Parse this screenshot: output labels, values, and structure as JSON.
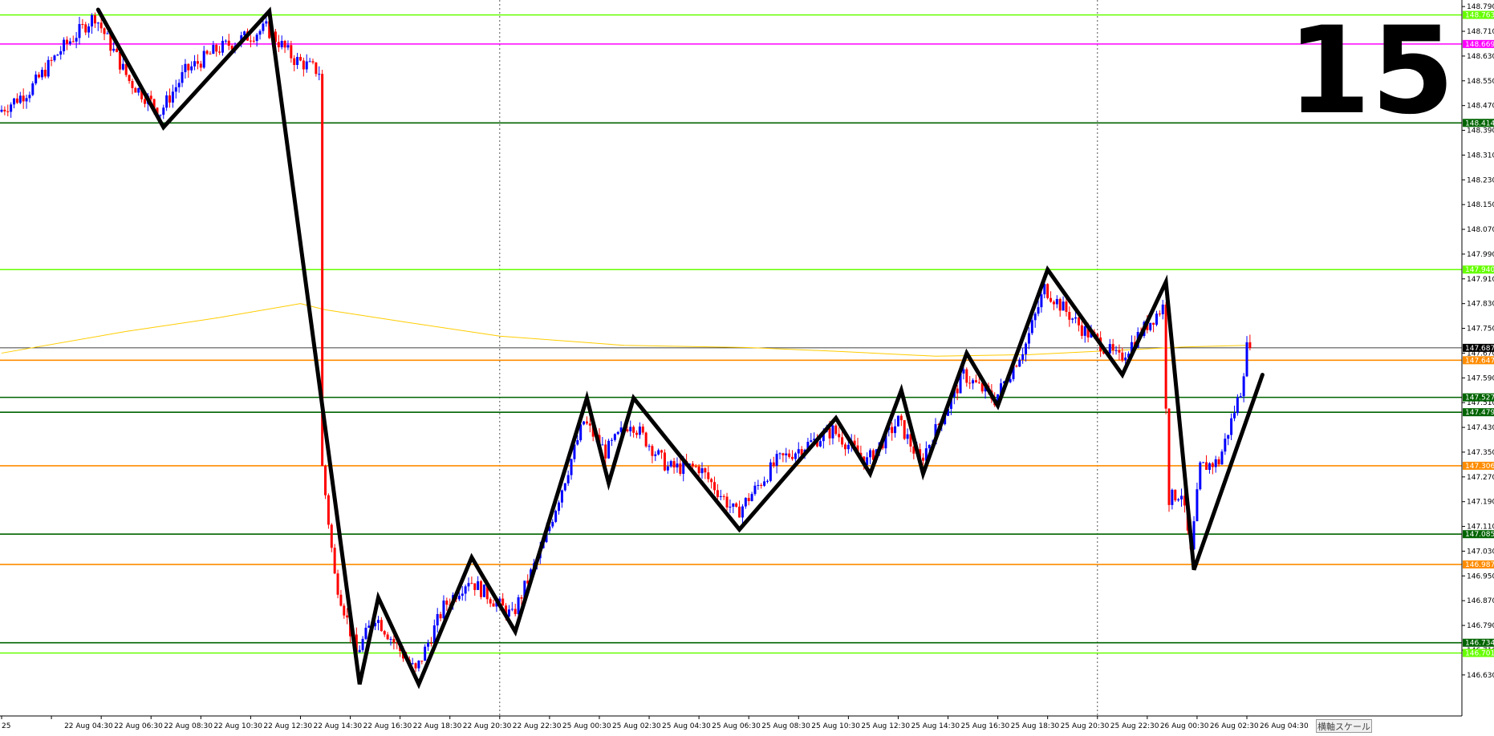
{
  "timeframe_label": "15",
  "scale_button_label": "横軸スケール",
  "colors": {
    "bull": "#0000ff",
    "bear": "#ff0000",
    "zigzag": "#000000",
    "ma": "#ffcc00",
    "light_green": "#66ff00",
    "magenta": "#ff00ff",
    "dark_green": "#006400",
    "orange": "#ff8c00",
    "current": "#000000"
  },
  "chart_data": {
    "type": "candlestick",
    "symbol_timeframe": "15",
    "ylim": [
      146.57,
      148.793
    ],
    "y_ticks": [
      "148.790",
      "148.710",
      "148.630",
      "148.550",
      "148.470",
      "148.390",
      "148.310",
      "148.230",
      "148.150",
      "148.070",
      "147.990",
      "147.910",
      "147.830",
      "147.750",
      "147.670",
      "147.590",
      "147.510",
      "147.430",
      "147.350",
      "147.270",
      "147.190",
      "147.110",
      "147.030",
      "146.950",
      "146.870",
      "146.790",
      "146.710",
      "146.630"
    ],
    "x_ticks": [
      "25",
      "22 Aug 04:30",
      "22 Aug 06:30",
      "22 Aug 08:30",
      "22 Aug 10:30",
      "22 Aug 12:30",
      "22 Aug 14:30",
      "22 Aug 16:30",
      "22 Aug 18:30",
      "22 Aug 20:30",
      "22 Aug 22:30",
      "25 Aug 00:30",
      "25 Aug 02:30",
      "25 Aug 04:30",
      "25 Aug 06:30",
      "25 Aug 08:30",
      "25 Aug 10:30",
      "25 Aug 12:30",
      "25 Aug 14:30",
      "25 Aug 16:30",
      "25 Aug 18:30",
      "25 Aug 20:30",
      "25 Aug 22:30",
      "26 Aug 00:30",
      "26 Aug 02:30",
      "26 Aug 04:30"
    ],
    "x_tick_positions": [
      0,
      16,
      32,
      48,
      64,
      80,
      96,
      112,
      128,
      144,
      160,
      176,
      192,
      208,
      224,
      240,
      256,
      272,
      288,
      304,
      320,
      336,
      352,
      368,
      384,
      400
    ],
    "bar_count": 404,
    "session_separators": [
      160,
      352
    ],
    "levels": [
      {
        "price": 148.763,
        "label": "148.763",
        "color": "light_green"
      },
      {
        "price": 148.669,
        "label": "148.669",
        "color": "magenta"
      },
      {
        "price": 148.414,
        "label": "148.414",
        "color": "dark_green"
      },
      {
        "price": 147.94,
        "label": "147.940",
        "color": "light_green"
      },
      {
        "price": 147.647,
        "label": "147.647",
        "color": "orange"
      },
      {
        "price": 147.527,
        "label": "147.527",
        "color": "dark_green"
      },
      {
        "price": 147.479,
        "label": "147.479",
        "color": "dark_green"
      },
      {
        "price": 147.306,
        "label": "147.306",
        "color": "orange"
      },
      {
        "price": 147.085,
        "label": "147.085",
        "color": "dark_green"
      },
      {
        "price": 146.987,
        "label": "146.987",
        "color": "orange"
      },
      {
        "price": 146.734,
        "label": "146.734",
        "color": "dark_green"
      },
      {
        "price": 146.701,
        "label": "146.701",
        "color": "light_green"
      }
    ],
    "current_price": {
      "price": 147.687,
      "label": "147.687"
    },
    "zigzag": [
      {
        "bar": 31,
        "price": 148.78
      },
      {
        "bar": 52,
        "price": 148.4
      },
      {
        "bar": 86,
        "price": 148.775
      },
      {
        "bar": 115,
        "price": 146.6
      },
      {
        "bar": 121,
        "price": 146.88
      },
      {
        "bar": 134,
        "price": 146.6
      },
      {
        "bar": 151,
        "price": 147.01
      },
      {
        "bar": 165,
        "price": 146.77
      },
      {
        "bar": 188,
        "price": 147.525
      },
      {
        "bar": 195,
        "price": 147.25
      },
      {
        "bar": 203,
        "price": 147.525
      },
      {
        "bar": 237,
        "price": 147.1
      },
      {
        "bar": 268,
        "price": 147.46
      },
      {
        "bar": 279,
        "price": 147.28
      },
      {
        "bar": 289,
        "price": 147.55
      },
      {
        "bar": 296,
        "price": 147.28
      },
      {
        "bar": 310,
        "price": 147.67
      },
      {
        "bar": 320,
        "price": 147.5
      },
      {
        "bar": 336,
        "price": 147.94
      },
      {
        "bar": 360,
        "price": 147.6
      },
      {
        "bar": 374,
        "price": 147.9
      },
      {
        "bar": 383,
        "price": 146.97
      },
      {
        "bar": 405,
        "price": 147.6
      }
    ],
    "moving_average": [
      {
        "bar": 0,
        "price": 147.67
      },
      {
        "bar": 40,
        "price": 147.74
      },
      {
        "bar": 70,
        "price": 147.785
      },
      {
        "bar": 96,
        "price": 147.83
      },
      {
        "bar": 104,
        "price": 147.81
      },
      {
        "bar": 130,
        "price": 147.77
      },
      {
        "bar": 160,
        "price": 147.725
      },
      {
        "bar": 200,
        "price": 147.695
      },
      {
        "bar": 240,
        "price": 147.688
      },
      {
        "bar": 270,
        "price": 147.675
      },
      {
        "bar": 300,
        "price": 147.66
      },
      {
        "bar": 330,
        "price": 147.665
      },
      {
        "bar": 360,
        "price": 147.68
      },
      {
        "bar": 380,
        "price": 147.69
      },
      {
        "bar": 400,
        "price": 147.695
      }
    ],
    "price_path": [
      {
        "bar": 0,
        "price": 148.45
      },
      {
        "bar": 10,
        "price": 148.52
      },
      {
        "bar": 20,
        "price": 148.65
      },
      {
        "bar": 31,
        "price": 148.76
      },
      {
        "bar": 42,
        "price": 148.55
      },
      {
        "bar": 52,
        "price": 148.45
      },
      {
        "bar": 60,
        "price": 148.58
      },
      {
        "bar": 70,
        "price": 148.65
      },
      {
        "bar": 86,
        "price": 148.72
      },
      {
        "bar": 95,
        "price": 148.62
      },
      {
        "bar": 103,
        "price": 148.58
      },
      {
        "bar": 104,
        "price": 147.3
      },
      {
        "bar": 108,
        "price": 146.95
      },
      {
        "bar": 115,
        "price": 146.7
      },
      {
        "bar": 121,
        "price": 146.82
      },
      {
        "bar": 134,
        "price": 146.64
      },
      {
        "bar": 143,
        "price": 146.85
      },
      {
        "bar": 151,
        "price": 146.94
      },
      {
        "bar": 165,
        "price": 146.82
      },
      {
        "bar": 175,
        "price": 147.05
      },
      {
        "bar": 188,
        "price": 147.45
      },
      {
        "bar": 195,
        "price": 147.35
      },
      {
        "bar": 203,
        "price": 147.45
      },
      {
        "bar": 215,
        "price": 147.3
      },
      {
        "bar": 225,
        "price": 147.3
      },
      {
        "bar": 237,
        "price": 147.15
      },
      {
        "bar": 250,
        "price": 147.32
      },
      {
        "bar": 268,
        "price": 147.42
      },
      {
        "bar": 279,
        "price": 147.32
      },
      {
        "bar": 289,
        "price": 147.45
      },
      {
        "bar": 296,
        "price": 147.32
      },
      {
        "bar": 310,
        "price": 147.6
      },
      {
        "bar": 320,
        "price": 147.52
      },
      {
        "bar": 330,
        "price": 147.7
      },
      {
        "bar": 336,
        "price": 147.88
      },
      {
        "bar": 348,
        "price": 147.75
      },
      {
        "bar": 360,
        "price": 147.65
      },
      {
        "bar": 368,
        "price": 147.75
      },
      {
        "bar": 374,
        "price": 147.82
      },
      {
        "bar": 376,
        "price": 147.2
      },
      {
        "bar": 380,
        "price": 147.22
      },
      {
        "bar": 383,
        "price": 147.02
      },
      {
        "bar": 386,
        "price": 147.3
      },
      {
        "bar": 392,
        "price": 147.32
      },
      {
        "bar": 396,
        "price": 147.45
      },
      {
        "bar": 399,
        "price": 147.55
      },
      {
        "bar": 401,
        "price": 147.687
      }
    ]
  }
}
